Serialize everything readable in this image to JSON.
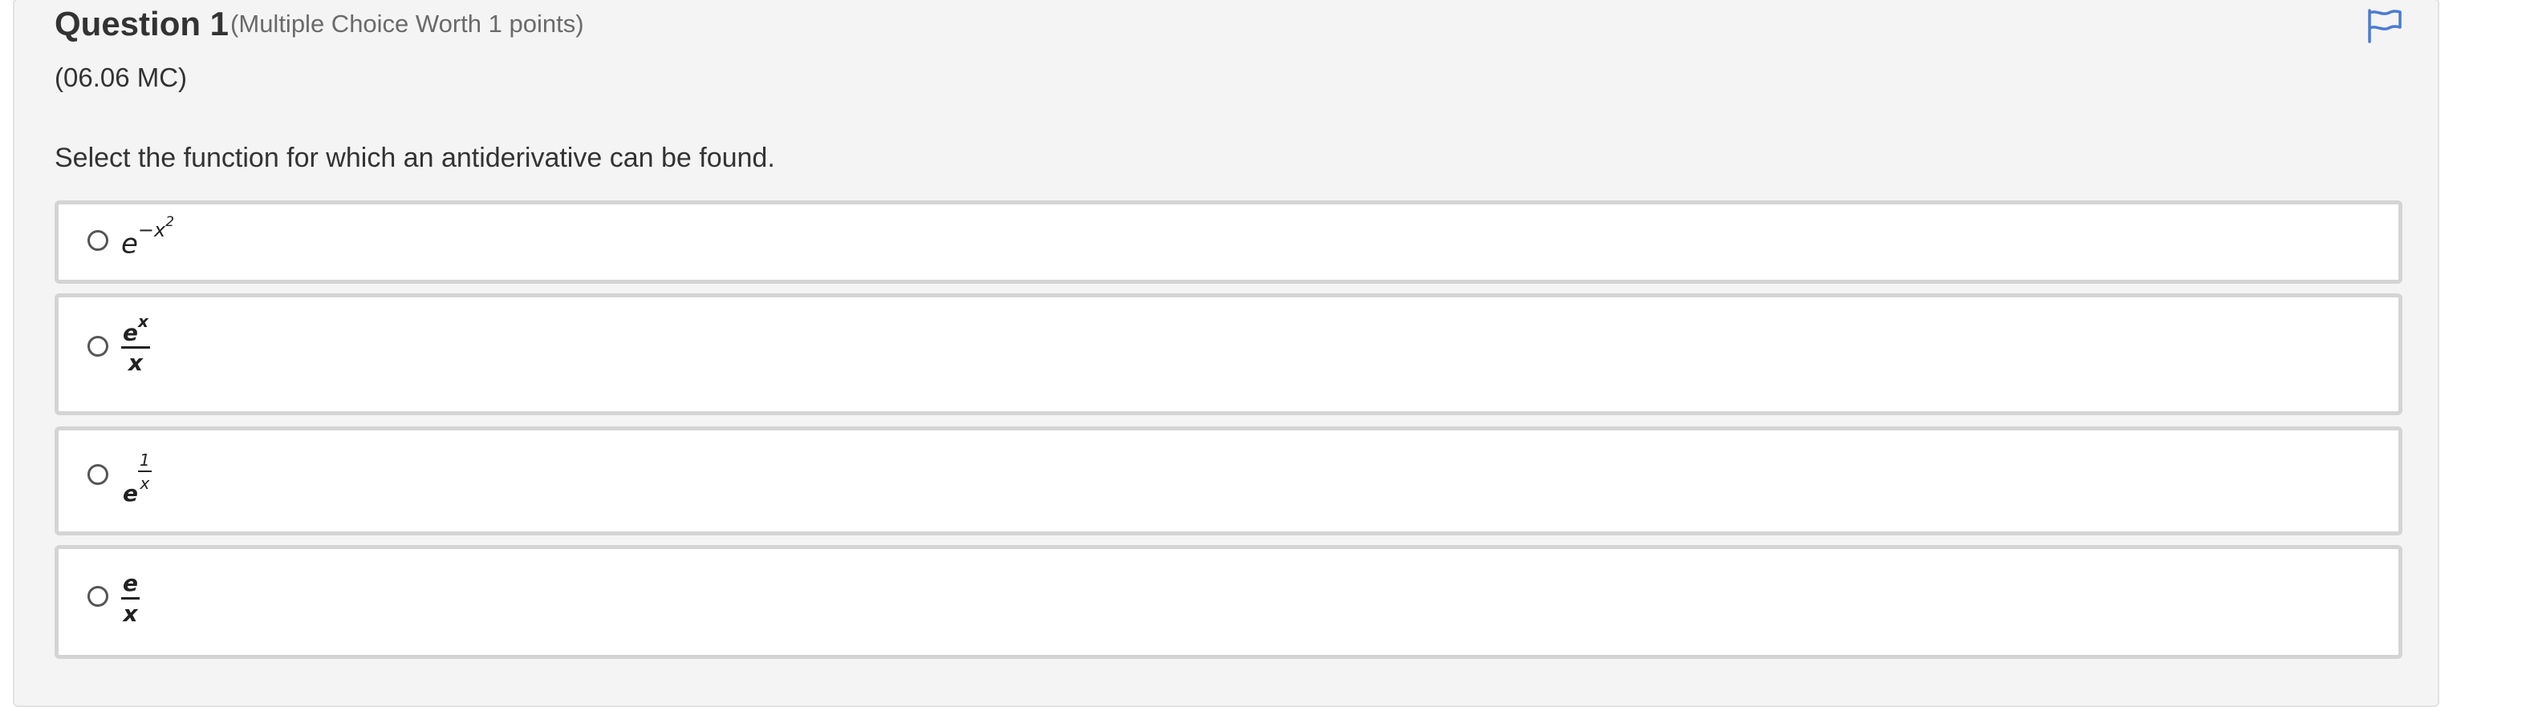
{
  "question": {
    "title": "Question 1",
    "worth": "(Multiple Choice Worth 1 points)",
    "code": "(06.06 MC)",
    "prompt": "Select the function for which an antiderivative can be found.",
    "flag_icon": "flag-icon"
  },
  "choices": [
    {
      "base": "e",
      "exponent": "−x",
      "exponent_power": "2",
      "selected": false
    },
    {
      "numerator_base": "e",
      "numerator_exponent": "x",
      "denominator": "x",
      "selected": false
    },
    {
      "base": "e",
      "exponent_numerator": "1",
      "exponent_denominator": "x",
      "selected": false
    },
    {
      "numerator": "e",
      "denominator": "x",
      "selected": false
    }
  ],
  "colors": {
    "panel_background": "#f4f4f4",
    "flag_icon": "#4a7bd0",
    "choice_border": "#d4d4d4"
  }
}
